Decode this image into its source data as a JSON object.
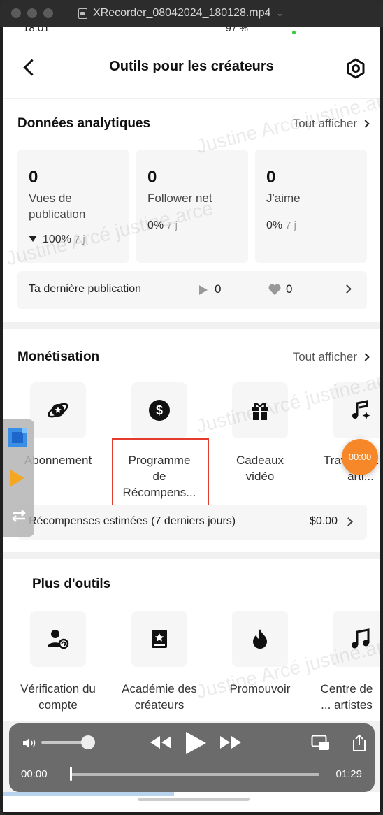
{
  "window": {
    "title": "XRecorder_08042024_180128.mp4"
  },
  "status": {
    "time": "18:01",
    "battery": "97 %"
  },
  "header": {
    "title": "Outils pour les créateurs"
  },
  "analytics": {
    "title": "Données analytiques",
    "see_all": "Tout afficher",
    "cards": [
      {
        "value": "0",
        "label": "Vues de publication",
        "change": "100%",
        "period": "7 j",
        "trend": "down"
      },
      {
        "value": "0",
        "label": "Follower net",
        "change": "0%",
        "period": "7 j"
      },
      {
        "value": "0",
        "label": "J'aime",
        "change": "0%",
        "period": "7 j"
      }
    ],
    "last_post": {
      "label": "Ta dernière publication",
      "views": "0",
      "likes": "0"
    }
  },
  "monetisation": {
    "title": "Monétisation",
    "see_all": "Tout afficher",
    "tools": [
      {
        "label": "Abonnement",
        "icon": "subscription-planet-icon"
      },
      {
        "label": "Programme de Récompens...",
        "icon": "dollar-coin-icon"
      },
      {
        "label": "Cadeaux vidéo",
        "icon": "gift-icon"
      },
      {
        "label": "Travaux ... les arti...",
        "icon": "music-note-sparkle-icon"
      }
    ],
    "rewards": {
      "label": "Récompenses estimées (7 derniers jours)",
      "value": "$0.00"
    }
  },
  "more_tools": {
    "title": "Plus d'outils",
    "tools": [
      {
        "label": "Vérification du compte",
        "icon": "user-verify-icon"
      },
      {
        "label": "Académie des créateurs",
        "icon": "book-star-icon"
      },
      {
        "label": "Promouvoir",
        "icon": "flame-icon"
      },
      {
        "label": "Centre de ... artistes",
        "icon": "music-note-icon"
      }
    ]
  },
  "watermark": "Justine Arcé justine.arce",
  "recorder": {
    "time": "00:00"
  },
  "player": {
    "current": "00:00",
    "total": "01:29",
    "progress": 0.0
  },
  "colors": {
    "highlight": "#e43b2e",
    "record": "#f7882a",
    "accent_orange": "#f5a623"
  }
}
